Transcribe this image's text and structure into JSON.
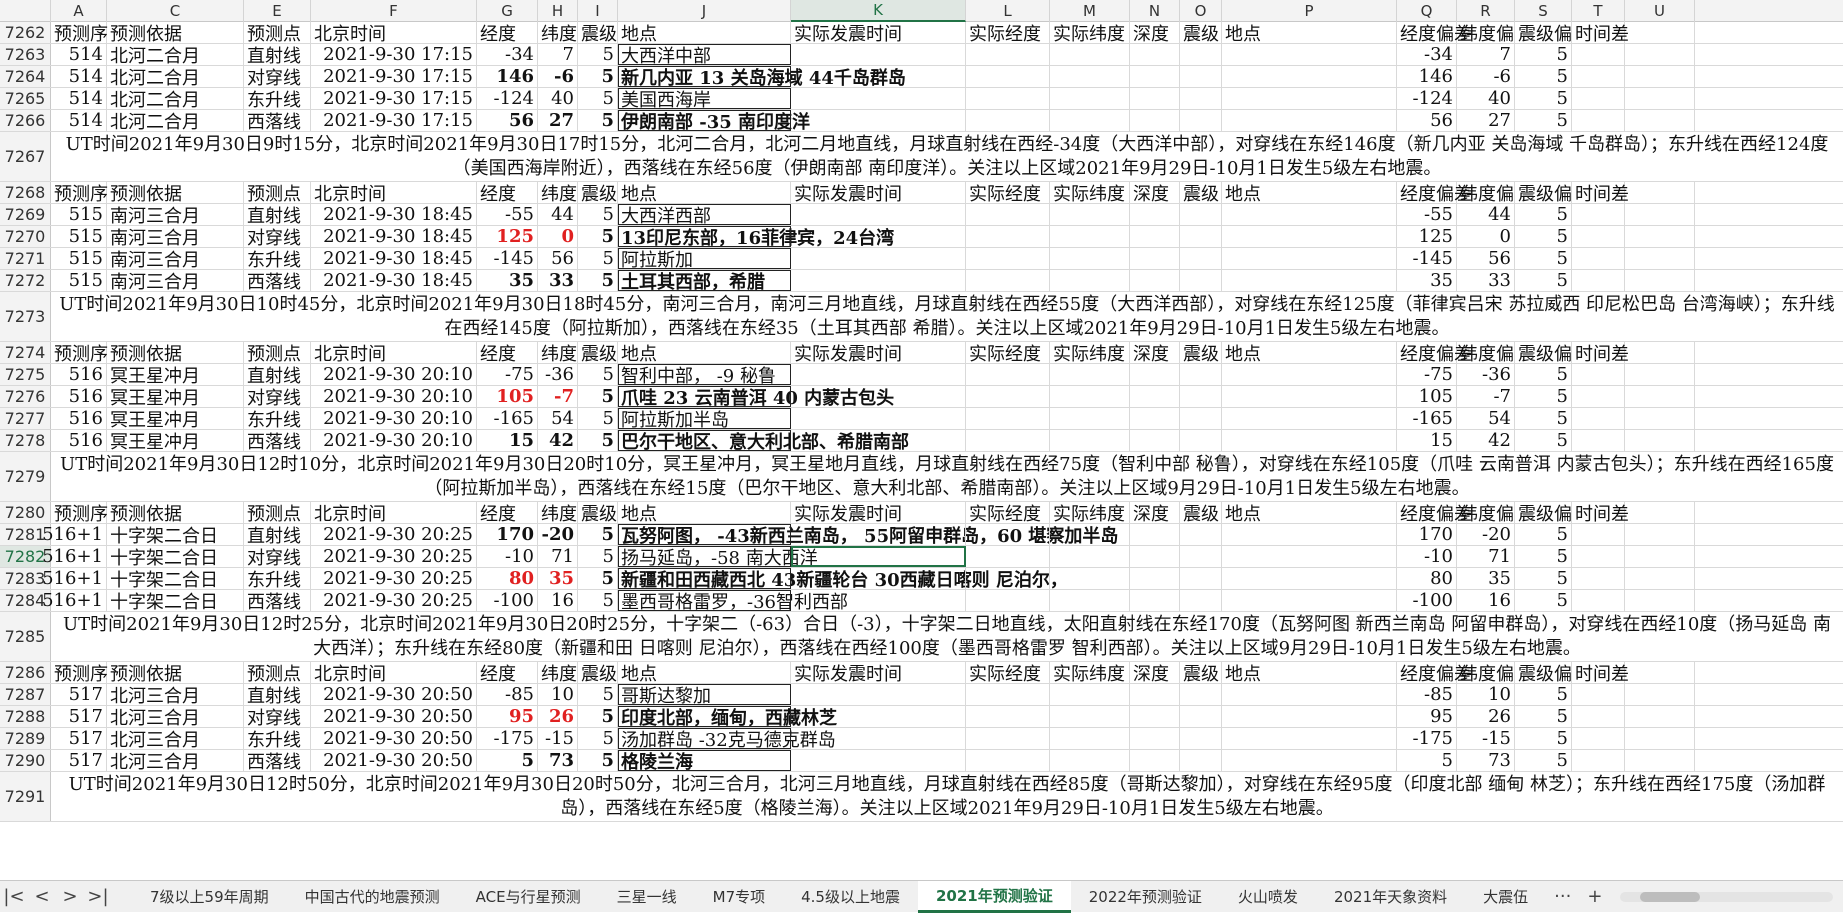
{
  "columns": [
    "A",
    "C",
    "E",
    "F",
    "G",
    "H",
    "I",
    "J",
    "K",
    "L",
    "M",
    "N",
    "O",
    "P",
    "Q",
    "R",
    "S",
    "T",
    "U"
  ],
  "header_row_labels": [
    "预测序",
    "预测依据",
    "预测点",
    "北京时间",
    "经度",
    "纬度",
    "震级",
    "地点",
    "实际发震时间",
    "实际经度",
    "实际纬度",
    "深度",
    "震级",
    "地点",
    "经度偏差",
    "纬度偏",
    "震级偏",
    "时间差"
  ],
  "rows": [
    {
      "rn": "7262",
      "type": "header"
    },
    {
      "rn": "7263",
      "type": "data",
      "seq": "514",
      "basis": "北河二合月",
      "point": "直射线",
      "time": "2021-9-30 17:15",
      "lon": "-34",
      "lat": "7",
      "mag": "5",
      "place": "大西洋中部",
      "q": "-34",
      "r": "7",
      "s": "5"
    },
    {
      "rn": "7264",
      "type": "data",
      "seq": "514",
      "basis": "北河二合月",
      "point": "对穿线",
      "time": "2021-9-30 17:15",
      "lon": "146",
      "lat": "-6",
      "mag": "5",
      "place": "新几内亚 13 关岛海域 44千岛群岛",
      "q": "146",
      "r": "-6",
      "s": "5",
      "bold": true
    },
    {
      "rn": "7265",
      "type": "data",
      "seq": "514",
      "basis": "北河二合月",
      "point": "东升线",
      "time": "2021-9-30 17:15",
      "lon": "-124",
      "lat": "40",
      "mag": "5",
      "place": "美国西海岸",
      "q": "-124",
      "r": "40",
      "s": "5"
    },
    {
      "rn": "7266",
      "type": "data",
      "seq": "514",
      "basis": "北河二合月",
      "point": "西落线",
      "time": "2021-9-30 17:15",
      "lon": "56",
      "lat": "27",
      "mag": "5",
      "place": "伊朗南部 -35 南印度洋",
      "q": "56",
      "r": "27",
      "s": "5",
      "bold": true
    },
    {
      "rn": "7267",
      "type": "note",
      "text": "UT时间2021年9月30日9时15分，北京时间2021年9月30日17时15分，北河二合月，北河二月地直线，月球直射线在西经-34度（大西洋中部），对穿线在东经146度（新几内亚 关岛海域 千岛群岛）；东升线在西经124度（美国西海岸附近），西落线在东经56度（伊朗南部 南印度洋）。关注以上区域2021年9月29日-10月1日发生5级左右地震。"
    },
    {
      "rn": "7268",
      "type": "header"
    },
    {
      "rn": "7269",
      "type": "data",
      "seq": "515",
      "basis": "南河三合月",
      "point": "直射线",
      "time": "2021-9-30 18:45",
      "lon": "-55",
      "lat": "44",
      "mag": "5",
      "place": "大西洋西部",
      "q": "-55",
      "r": "44",
      "s": "5"
    },
    {
      "rn": "7270",
      "type": "data",
      "seq": "515",
      "basis": "南河三合月",
      "point": "对穿线",
      "time": "2021-9-30 18:45",
      "lon": "125",
      "lat": "0",
      "mag": "5",
      "place": "13印尼东部，16菲律宾，24台湾",
      "q": "125",
      "r": "0",
      "s": "5",
      "bold": true,
      "red": true
    },
    {
      "rn": "7271",
      "type": "data",
      "seq": "515",
      "basis": "南河三合月",
      "point": "东升线",
      "time": "2021-9-30 18:45",
      "lon": "-145",
      "lat": "56",
      "mag": "5",
      "place": "阿拉斯加",
      "q": "-145",
      "r": "56",
      "s": "5"
    },
    {
      "rn": "7272",
      "type": "data",
      "seq": "515",
      "basis": "南河三合月",
      "point": "西落线",
      "time": "2021-9-30 18:45",
      "lon": "35",
      "lat": "33",
      "mag": "5",
      "place": "土耳其西部，希腊",
      "q": "35",
      "r": "33",
      "s": "5",
      "bold": true
    },
    {
      "rn": "7273",
      "type": "note",
      "text": "UT时间2021年9月30日10时45分，北京时间2021年9月30日18时45分，南河三合月，南河三月地直线，月球直射线在西经55度（大西洋西部），对穿线在东经125度（菲律宾吕宋 苏拉威西 印尼松巴岛 台湾海峡）；东升线在西经145度（阿拉斯加），西落线在东经35（土耳其西部 希腊）。关注以上区域2021年9月29日-10月1日发生5级左右地震。"
    },
    {
      "rn": "7274",
      "type": "header"
    },
    {
      "rn": "7275",
      "type": "data",
      "seq": "516",
      "basis": "冥王星冲月",
      "point": "直射线",
      "time": "2021-9-30 20:10",
      "lon": "-75",
      "lat": "-36",
      "mag": "5",
      "place": "智利中部， -9 秘鲁",
      "q": "-75",
      "r": "-36",
      "s": "5"
    },
    {
      "rn": "7276",
      "type": "data",
      "seq": "516",
      "basis": "冥王星冲月",
      "point": "对穿线",
      "time": "2021-9-30 20:10",
      "lon": "105",
      "lat": "-7",
      "mag": "5",
      "place": "爪哇 23 云南普洱 40 内蒙古包头",
      "q": "105",
      "r": "-7",
      "s": "5",
      "bold": true,
      "red": true
    },
    {
      "rn": "7277",
      "type": "data",
      "seq": "516",
      "basis": "冥王星冲月",
      "point": "东升线",
      "time": "2021-9-30 20:10",
      "lon": "-165",
      "lat": "54",
      "mag": "5",
      "place": "阿拉斯加半岛",
      "q": "-165",
      "r": "54",
      "s": "5"
    },
    {
      "rn": "7278",
      "type": "data",
      "seq": "516",
      "basis": "冥王星冲月",
      "point": "西落线",
      "time": "2021-9-30 20:10",
      "lon": "15",
      "lat": "42",
      "mag": "5",
      "place": "巴尔干地区、意大利北部、希腊南部",
      "q": "15",
      "r": "42",
      "s": "5",
      "bold": true
    },
    {
      "rn": "7279",
      "type": "note",
      "text": "UT时间2021年9月30日12时10分，北京时间2021年9月30日20时10分，冥王星冲月，冥王星地月直线，月球直射线在西经75度（智利中部 秘鲁），对穿线在东经105度（爪哇 云南普洱 内蒙古包头）；东升线在西经165度（阿拉斯加半岛），西落线在东经15度（巴尔干地区、意大利北部、希腊南部）。关注以上区域9月29日-10月1日发生5级左右地震。"
    },
    {
      "rn": "7280",
      "type": "header"
    },
    {
      "rn": "7281",
      "type": "data",
      "seq": "516+1",
      "basis": "十字架二合日",
      "point": "直射线",
      "time": "2021-9-30 20:25",
      "lon": "170",
      "lat": "-20",
      "mag": "5",
      "place": "瓦努阿图， -43新西兰南岛， 55阿留申群岛，60 堪察加半岛",
      "q": "170",
      "r": "-20",
      "s": "5",
      "bold": true,
      "boldnum": true
    },
    {
      "rn": "7282",
      "type": "data",
      "seq": "516+1",
      "basis": "十字架二合日",
      "point": "对穿线",
      "time": "2021-9-30 20:25",
      "lon": "-10",
      "lat": "71",
      "mag": "5",
      "place": "扬马延岛，-58 南大西洋",
      "q": "-10",
      "r": "71",
      "s": "5",
      "selected": true
    },
    {
      "rn": "7283",
      "type": "data",
      "seq": "516+1",
      "basis": "十字架二合日",
      "point": "东升线",
      "time": "2021-9-30 20:25",
      "lon": "80",
      "lat": "35",
      "mag": "5",
      "place": "新疆和田西藏西北 43新疆轮台 30西藏日喀则 尼泊尔，",
      "q": "80",
      "r": "35",
      "s": "5",
      "bold": true,
      "red": true
    },
    {
      "rn": "7284",
      "type": "data",
      "seq": "516+1",
      "basis": "十字架二合日",
      "point": "西落线",
      "time": "2021-9-30 20:25",
      "lon": "-100",
      "lat": "16",
      "mag": "5",
      "place": "墨西哥格雷罗，-36智利西部",
      "q": "-100",
      "r": "16",
      "s": "5"
    },
    {
      "rn": "7285",
      "type": "note",
      "text": "UT时间2021年9月30日12时25分，北京时间2021年9月30日20时25分，十字架二（-63）合日（-3），十字架二日地直线，太阳直射线在东经170度（瓦努阿图 新西兰南岛 阿留申群岛），对穿线在西经10度（扬马延岛 南大西洋）；东升线在东经80度（新疆和田 日喀则 尼泊尔），西落线在西经100度（墨西哥格雷罗 智利西部）。关注以上区域9月29日-10月1日发生5级左右地震。"
    },
    {
      "rn": "7286",
      "type": "header"
    },
    {
      "rn": "7287",
      "type": "data",
      "seq": "517",
      "basis": "北河三合月",
      "point": "直射线",
      "time": "2021-9-30 20:50",
      "lon": "-85",
      "lat": "10",
      "mag": "5",
      "place": "哥斯达黎加",
      "q": "-85",
      "r": "10",
      "s": "5"
    },
    {
      "rn": "7288",
      "type": "data",
      "seq": "517",
      "basis": "北河三合月",
      "point": "对穿线",
      "time": "2021-9-30 20:50",
      "lon": "95",
      "lat": "26",
      "mag": "5",
      "place": "印度北部，缅甸，西藏林芝",
      "q": "95",
      "r": "26",
      "s": "5",
      "bold": true,
      "red": true
    },
    {
      "rn": "7289",
      "type": "data",
      "seq": "517",
      "basis": "北河三合月",
      "point": "东升线",
      "time": "2021-9-30 20:50",
      "lon": "-175",
      "lat": "-15",
      "mag": "5",
      "place": "汤加群岛 -32克马德克群岛",
      "q": "-175",
      "r": "-15",
      "s": "5"
    },
    {
      "rn": "7290",
      "type": "data",
      "seq": "517",
      "basis": "北河三合月",
      "point": "西落线",
      "time": "2021-9-30 20:50",
      "lon": "5",
      "lat": "73",
      "mag": "5",
      "place": "格陵兰海",
      "q": "5",
      "r": "73",
      "s": "5",
      "bold": true
    },
    {
      "rn": "7291",
      "type": "note",
      "text": "UT时间2021年9月30日12时50分，北京时间2021年9月30日20时50分，北河三合月，北河三月地直线，月球直射线在西经85度（哥斯达黎加），对穿线在东经95度（印度北部 缅甸 林芝）；东升线在西经175度（汤加群岛），西落线在东经5度（格陵兰海）。关注以上区域2021年9月29日-10月1日发生5级左右地震。"
    }
  ],
  "tabs": [
    "7级以上59年周期",
    "中国古代的地震预测",
    "ACE与行星预测",
    "三星一线",
    "M7专项",
    "4.5级以上地震",
    "2021年预测验证",
    "2022年预测验证",
    "火山喷发",
    "2021年天象资料",
    "大震伍"
  ],
  "active_tab": "2021年预测验证",
  "colors": {
    "accent": "#217346",
    "red": "#e02020"
  }
}
